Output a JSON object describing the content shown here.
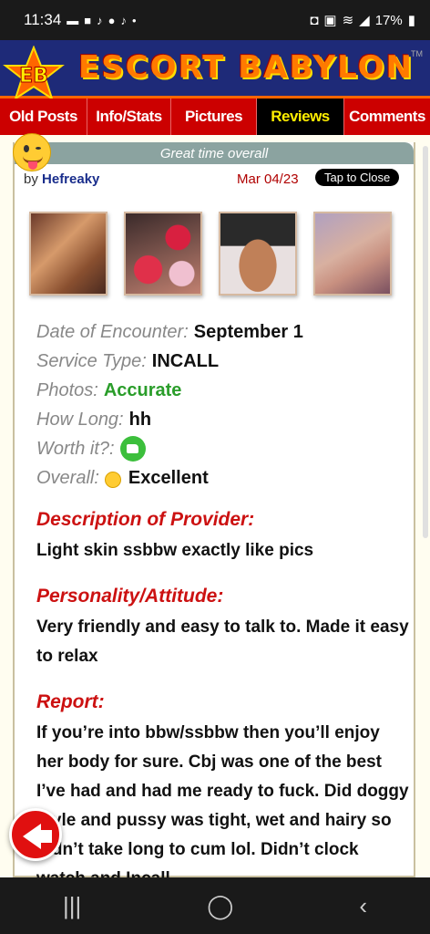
{
  "status_bar": {
    "time": "11:34",
    "left_icons": [
      "sms-icon",
      "lock-icon",
      "tiktok-icon",
      "messenger-icon",
      "tiktok-icon",
      "dot-icon"
    ],
    "battery": "17%"
  },
  "header": {
    "logo_text": "EB",
    "title": "ESCORT BABYLON",
    "trademark": "TM"
  },
  "nav": {
    "tabs": [
      {
        "label": "Old Posts"
      },
      {
        "label": "Info/Stats"
      },
      {
        "label": "Pictures"
      },
      {
        "label": "Reviews",
        "active": true
      },
      {
        "label": "Comments"
      }
    ]
  },
  "review": {
    "headline": "Great time overall",
    "by_prefix": "by",
    "author": "Hefreaky",
    "date": "Mar 04/23",
    "tap_close": "Tap to Close",
    "fields": [
      {
        "label": "Date of Encounter:",
        "value": "September 1"
      },
      {
        "label": "Service Type:",
        "value": "INCALL"
      },
      {
        "label": "Photos:",
        "value": "Accurate"
      },
      {
        "label": "How Long:",
        "value": "hh"
      },
      {
        "label": "Worth it?:",
        "value": ""
      },
      {
        "label": "Overall:",
        "value": "Excellent"
      }
    ],
    "sections": [
      {
        "title": "Description of Provider:",
        "text": "Light skin ssbbw exactly like pics"
      },
      {
        "title": "Personality/Attitude:",
        "text": "Very friendly and easy to talk to. Made it easy to relax"
      },
      {
        "title": "Report:",
        "text": "If you’re into bbw/ssbbw then you’ll enjoy her body for sure. Cbj was one of the best I’ve had and had me ready to fuck. Did doggy style and pussy was tight, wet and hairy so didn’t take long to cum lol. Didn’t clock watch and Incall"
      }
    ]
  },
  "colors": {
    "nav_red": "#cc0000",
    "banner_blue": "#1e2a78",
    "title_orange": "#ff7a00",
    "section_red": "#cc1111",
    "accurate_green": "#2a9d2a"
  },
  "android_nav": {
    "recent": "|||",
    "home": "◯",
    "back": "‹"
  }
}
